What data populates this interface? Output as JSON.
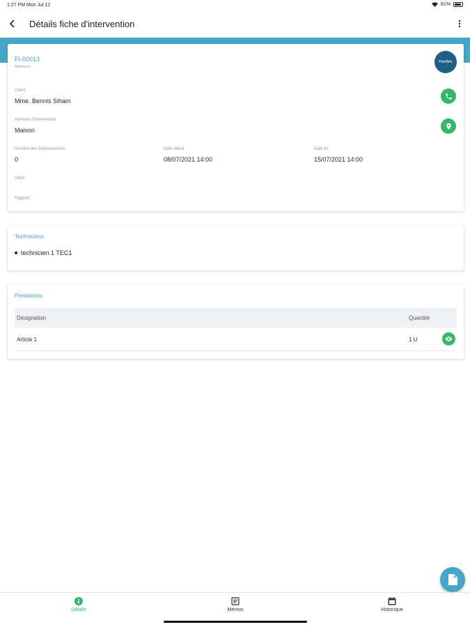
{
  "status_bar": {
    "time": "1:27 PM  Mon Jul 12",
    "battery": "81%"
  },
  "app_bar": {
    "title": "Détails fiche d'intervention"
  },
  "intervention": {
    "ref": "FI-00013",
    "ref_sub": "Référence",
    "status": "Planifiée",
    "client_label": "Client",
    "client_value": "Mme. Bennis Siham",
    "address_label": "Adresse d'intervention",
    "address_value": "Maison",
    "trips_label": "Nombre des Déplacements",
    "trips_value": "0",
    "start_label": "Date début",
    "start_value": "08/07/2021 14:00",
    "end_label": "Date fin",
    "end_value": "15/07/2021 14:00",
    "object_label": "Objet",
    "report_label": "Rapport"
  },
  "technicians": {
    "title": "Techniciens",
    "items": [
      "technicien 1 TEC1"
    ]
  },
  "services": {
    "title": "Prestations",
    "headers": {
      "designation": "Désignation",
      "quantity": "Quantité"
    },
    "rows": [
      {
        "designation": "Article 1",
        "quantity": "1 U"
      }
    ]
  },
  "bottom_nav": {
    "items": [
      {
        "label": "Détails",
        "icon": "info-icon",
        "active": true
      },
      {
        "label": "Mémos",
        "icon": "memo-icon",
        "active": false
      },
      {
        "label": "Historique",
        "icon": "history-icon",
        "active": false
      }
    ]
  },
  "colors": {
    "accent": "#46a6c7",
    "green": "#35b56f",
    "status_badge": "#1f5f86"
  }
}
